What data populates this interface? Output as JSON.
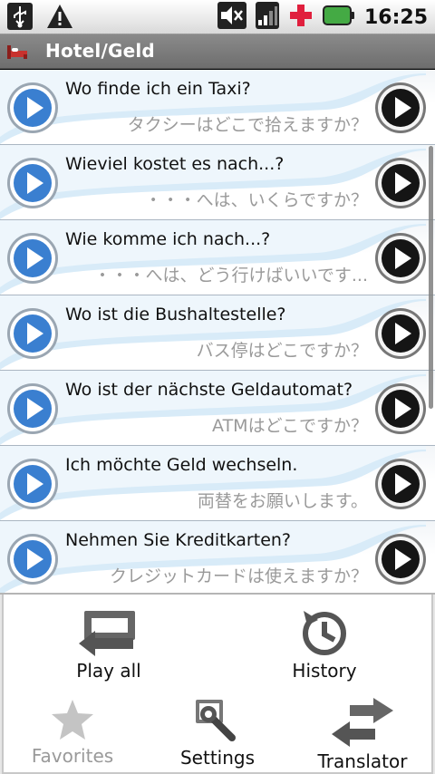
{
  "status": {
    "time": "16:25",
    "icons": [
      "usb-icon",
      "warning-icon",
      "mute-icon",
      "signal-icon",
      "health-cross-icon",
      "battery-icon"
    ]
  },
  "titlebar": {
    "title": "Hotel/Geld",
    "icon": "bed-icon"
  },
  "phrases": [
    {
      "de": "Wo finde ich ein Taxi?",
      "jp": "タクシーはどこで拾えますか？"
    },
    {
      "de": "Wieviel kostet es nach...?",
      "jp": "・・・へは、いくらですか？"
    },
    {
      "de": "Wie komme ich nach...?",
      "jp": "・・・へは、どう行けばいいです..."
    },
    {
      "de": "Wo ist die Bushaltestelle?",
      "jp": "バス停はどこですか？"
    },
    {
      "de": "Wo ist der nächste Geldautomat?",
      "jp": "ATMはどこですか？"
    },
    {
      "de": "Ich möchte Geld wechseln.",
      "jp": "両替をお願いします。"
    },
    {
      "de": "Nehmen Sie Kreditkarten?",
      "jp": "クレジットカードは使えますか？"
    }
  ],
  "menu": {
    "play_all": "Play all",
    "history": "History",
    "favorites": "Favorites",
    "settings": "Settings",
    "translator": "Translator"
  },
  "colors": {
    "accent_blue": "#3a7fd0",
    "row_wave": "#bcdcf2",
    "titlebar": "#7b7b7b"
  }
}
